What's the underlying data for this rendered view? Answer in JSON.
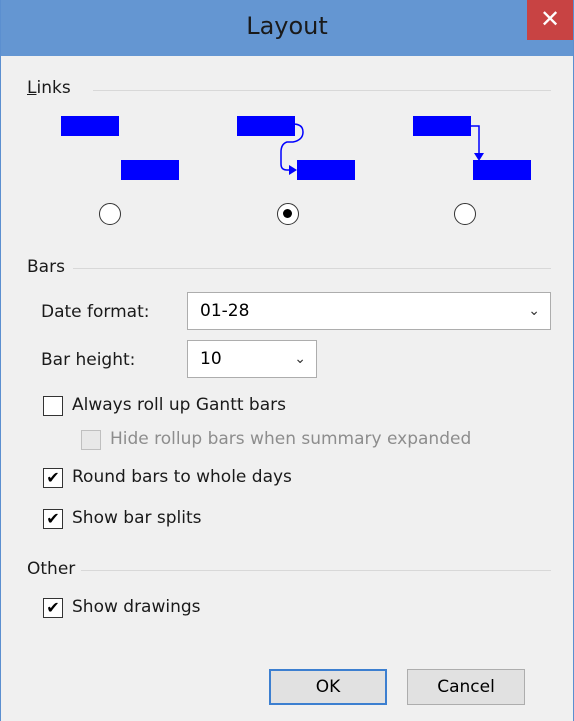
{
  "dialog": {
    "title": "Layout",
    "close_glyph": "✕"
  },
  "links": {
    "label_prefix": "L",
    "label_rest": "inks",
    "options": [
      {
        "id": "link-none",
        "selected": false
      },
      {
        "id": "link-s-curve",
        "selected": true
      },
      {
        "id": "link-straight",
        "selected": false
      }
    ],
    "bar_color": "#0000ff"
  },
  "bars": {
    "label": "Bars",
    "date_format_label": "Date format:",
    "date_format_value": "01-28",
    "bar_height_label": "Bar height:",
    "bar_height_value": "10",
    "always_roll_up": {
      "label": "Always roll up Gantt bars",
      "checked": false
    },
    "hide_rollup": {
      "label": "Hide rollup bars when summary expanded",
      "checked": false,
      "disabled": true
    },
    "round_bars": {
      "label": "Round bars to whole days",
      "checked": true
    },
    "show_splits": {
      "label": "Show bar splits",
      "checked": true
    }
  },
  "other": {
    "label": "Other",
    "show_drawings": {
      "label": "Show drawings",
      "checked": true
    }
  },
  "buttons": {
    "ok": "OK",
    "cancel": "Cancel"
  },
  "check_glyph": "✔",
  "chevron_glyph": "⌄"
}
